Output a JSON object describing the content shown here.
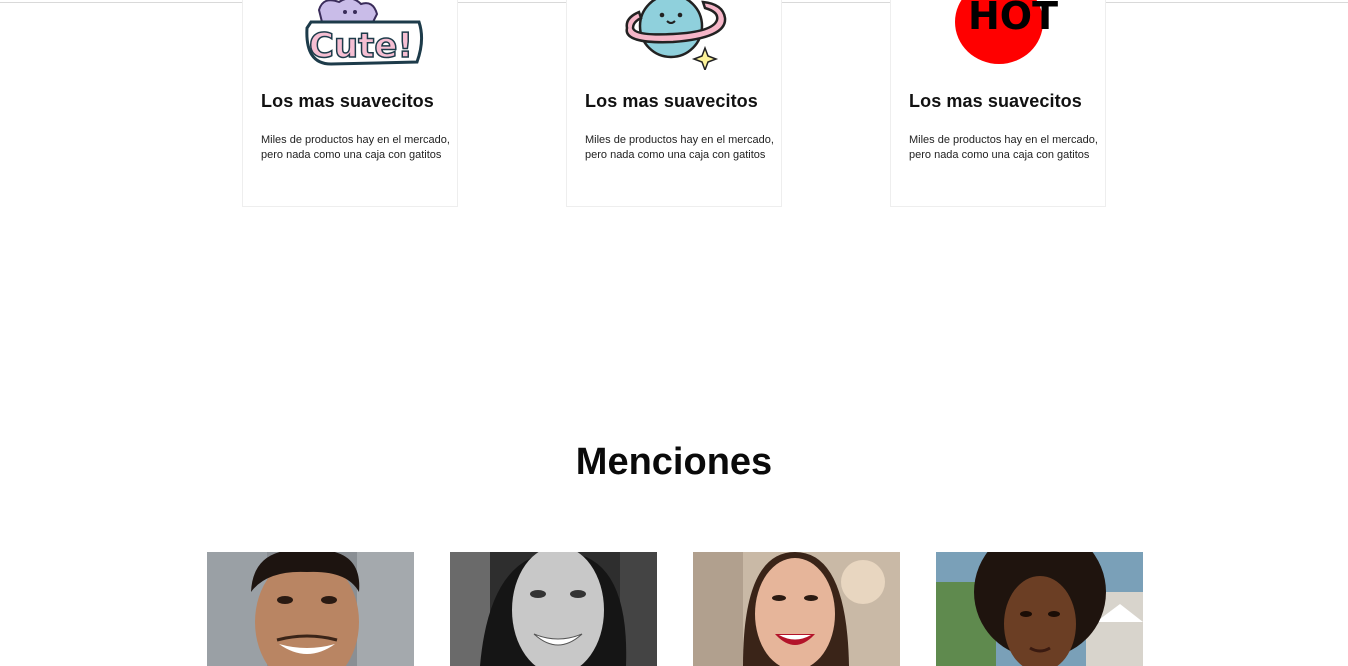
{
  "features": {
    "cards": [
      {
        "sticker": "cute-sticker",
        "title": "Los mas suavecitos",
        "text": "Miles de productos hay en el mercado, pero nada como una caja con gatitos",
        "sticker_text": "Cute!"
      },
      {
        "sticker": "planet-sticker",
        "title": "Los mas suavecitos",
        "text": "Miles de productos hay en el mercado, pero nada como una caja con gatitos"
      },
      {
        "sticker": "hot-sticker",
        "title": "Los mas suavecitos",
        "text": "Miles de productos hay en el mercado, pero nada como una caja con gatitos",
        "sticker_text": "HOT"
      }
    ]
  },
  "mentions": {
    "title": "Menciones",
    "photos": [
      {
        "alt": "portrait-man-smiling"
      },
      {
        "alt": "portrait-woman-black-and-white"
      },
      {
        "alt": "portrait-woman-laughing"
      },
      {
        "alt": "portrait-woman-curly-hair"
      }
    ]
  },
  "colors": {
    "hot_red": "#ff0000",
    "planet_blue": "#8fd0dc",
    "planet_ring": "#f6b6c8"
  }
}
